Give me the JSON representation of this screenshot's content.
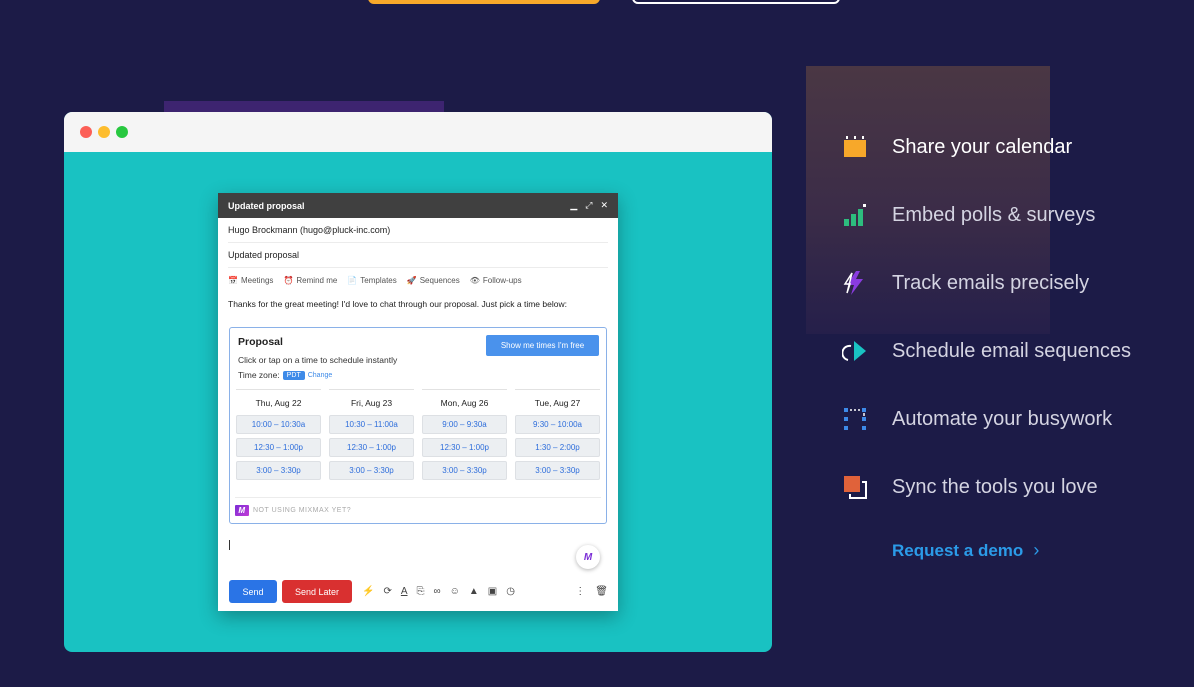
{
  "compose": {
    "title": "Updated proposal",
    "to": "Hugo Brockmann (hugo@pluck-inc.com)",
    "subject": "Updated proposal",
    "toolbar": [
      {
        "icon": "calendar-icon",
        "glyph": "📅",
        "label": "Meetings"
      },
      {
        "icon": "alarm-clock-icon",
        "glyph": "⏰",
        "label": "Remind me"
      },
      {
        "icon": "document-icon",
        "glyph": "📄",
        "label": "Templates"
      },
      {
        "icon": "rocket-icon",
        "glyph": "🚀",
        "label": "Sequences"
      },
      {
        "icon": "follow-up-icon",
        "glyph": "👁",
        "label": "Follow-ups"
      }
    ],
    "body_text": "Thanks for the great meeting! I'd love to chat through our proposal. Just pick a time below:",
    "proposal": {
      "title": "Proposal",
      "subtitle": "Click or tap on a time to schedule instantly",
      "timezone_label": "Time zone:",
      "timezone": "PDT",
      "change_label": "Change",
      "show_button": "Show me times I'm free",
      "days": [
        {
          "label": "Thu, Aug 22",
          "slots": [
            "10:00 – 10:30a",
            "12:30 – 1:00p",
            "3:00 – 3:30p"
          ]
        },
        {
          "label": "Fri, Aug 23",
          "slots": [
            "10:30 – 11:00a",
            "12:30 – 1:00p",
            "3:00 – 3:30p"
          ]
        },
        {
          "label": "Mon, Aug 26",
          "slots": [
            "9:00 – 9:30a",
            "12:30 – 1:00p",
            "3:00 – 3:30p"
          ]
        },
        {
          "label": "Tue, Aug 27",
          "slots": [
            "9:30 – 10:00a",
            "1:30 – 2:00p",
            "3:00 – 3:30p"
          ]
        }
      ],
      "footer": "NOT USING MIXMAX YET?"
    },
    "send_label": "Send",
    "send_later_label": "Send Later"
  },
  "features": [
    {
      "label": "Share your calendar",
      "icon": "calendar-icon",
      "active": true
    },
    {
      "label": "Embed polls & surveys",
      "icon": "bar-chart-icon",
      "active": false
    },
    {
      "label": "Track emails precisely",
      "icon": "lightning-icon",
      "active": false
    },
    {
      "label": "Schedule email sequences",
      "icon": "play-cycle-icon",
      "active": false
    },
    {
      "label": "Automate your busywork",
      "icon": "automation-icon",
      "active": false
    },
    {
      "label": "Sync the tools you love",
      "icon": "sync-squares-icon",
      "active": false
    }
  ],
  "demo_link": "Request a demo",
  "colors": {
    "background": "#1c1b47",
    "teal": "#19c2c2",
    "accent_orange": "#f7a82a",
    "link_blue": "#2b9be8",
    "send_blue": "#2a74e6",
    "send_later_red": "#d93030"
  }
}
